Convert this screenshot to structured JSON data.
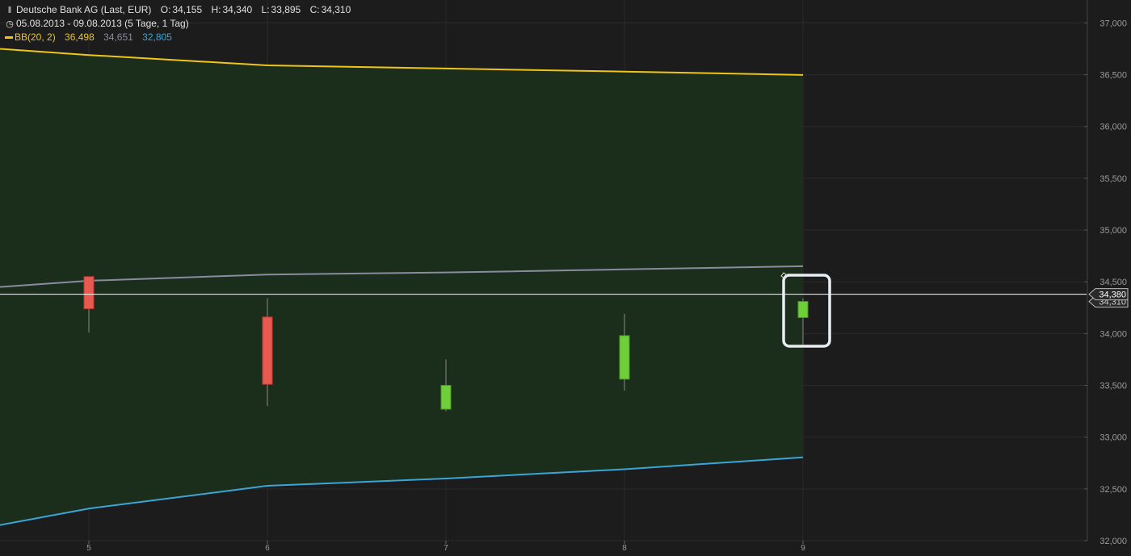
{
  "header": {
    "instrument": "Deutsche Bank AG (Last, EUR)",
    "o_label": "O:",
    "o_value": "34,155",
    "h_label": "H:",
    "h_value": "34,340",
    "l_label": "L:",
    "l_value": "33,895",
    "c_label": "C:",
    "c_value": "34,310",
    "period": "05.08.2013 - 09.08.2013 (5 Tage, 1 Tag)",
    "indicator": "BB(20, 2)",
    "bb_upper_value": "36,498",
    "bb_mid_value": "34,651",
    "bb_lower_value": "32,805",
    "icons": {
      "candle": "candlestick-icon",
      "clock": "clock-icon"
    }
  },
  "chart_data": {
    "type": "candlestick",
    "x": [
      5,
      6,
      7,
      8,
      9
    ],
    "x_tick_labels": [
      "5",
      "6",
      "7",
      "8",
      "9"
    ],
    "ohlc": [
      {
        "x": 5,
        "open": 34550,
        "high": 34550,
        "low": 34010,
        "close": 34240
      },
      {
        "x": 6,
        "open": 34160,
        "high": 34340,
        "low": 33300,
        "close": 33510
      },
      {
        "x": 7,
        "open": 33270,
        "high": 33750,
        "low": 33250,
        "close": 33500
      },
      {
        "x": 8,
        "open": 33560,
        "high": 34190,
        "low": 33450,
        "close": 33980
      },
      {
        "x": 9,
        "open": 34155,
        "high": 34340,
        "low": 33895,
        "close": 34310
      }
    ],
    "bollinger": {
      "name": "BB(20, 2)",
      "x": [
        4.5,
        5,
        6,
        7,
        8,
        9
      ],
      "upper": [
        36750,
        36690,
        36590,
        36560,
        36530,
        36498
      ],
      "middle": [
        34450,
        34510,
        34570,
        34590,
        34620,
        34651
      ],
      "lower": [
        32150,
        32310,
        32530,
        32600,
        32690,
        32805
      ]
    },
    "last_price": 34380,
    "last_price_label": "34,380",
    "close_label": "34,310",
    "ylim": [
      32000,
      37050
    ],
    "y_ticks": [
      32000,
      32500,
      33000,
      33500,
      34000,
      34500,
      35000,
      35500,
      36000,
      36500,
      37000
    ],
    "y_tick_labels": [
      "32,000",
      "32,500",
      "33,000",
      "33,500",
      "34,000",
      "34,500",
      "35,000",
      "35,500",
      "36,000",
      "36,500",
      "37,000"
    ],
    "grid": true,
    "colors": {
      "background": "#1c1c1c",
      "band_fill": "#1b2e1b",
      "up": "#6fcf3a",
      "down": "#e85a50",
      "upper": "#f0c419",
      "middle": "#8a8aa0",
      "lower": "#3aa5d8",
      "highlight": "#e8eef2",
      "price_line": "#ffffff"
    }
  }
}
